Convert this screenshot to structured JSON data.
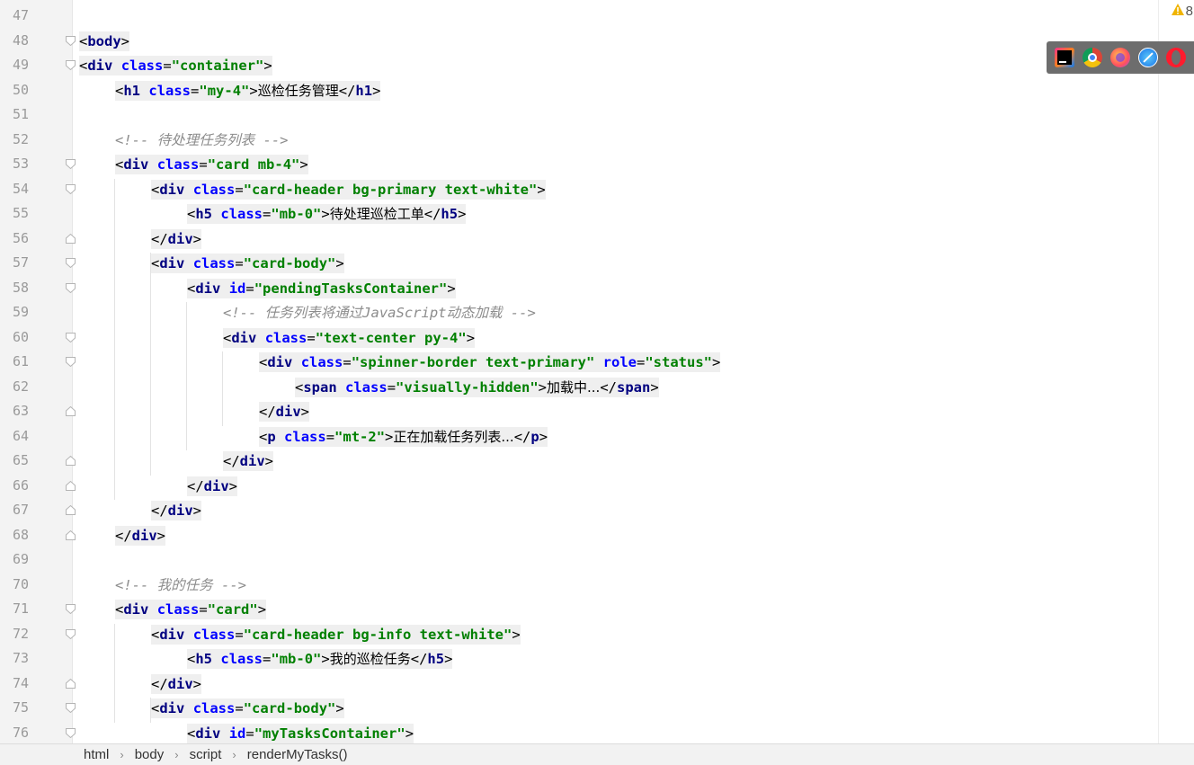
{
  "editor": {
    "lines": [
      {
        "n": "47",
        "indent": 0,
        "fold": "",
        "segs": []
      },
      {
        "n": "48",
        "indent": 0,
        "fold": "open",
        "segs": [
          [
            "punc",
            "<"
          ],
          [
            "tag",
            "body"
          ],
          [
            "punc",
            ">"
          ]
        ]
      },
      {
        "n": "49",
        "indent": 0,
        "fold": "open",
        "segs": [
          [
            "punc",
            "<"
          ],
          [
            "tag",
            "div"
          ],
          [
            "sp",
            " "
          ],
          [
            "attr",
            "class"
          ],
          [
            "punc",
            "="
          ],
          [
            "val",
            "\"container\""
          ],
          [
            "punc",
            ">"
          ]
        ]
      },
      {
        "n": "50",
        "indent": 1,
        "fold": "",
        "segs": [
          [
            "punc",
            "<"
          ],
          [
            "tag",
            "h1"
          ],
          [
            "sp",
            " "
          ],
          [
            "attr",
            "class"
          ],
          [
            "punc",
            "="
          ],
          [
            "val",
            "\"my-4\""
          ],
          [
            "punc",
            ">"
          ],
          [
            "txt",
            "巡检任务管理"
          ],
          [
            "punc",
            "</"
          ],
          [
            "tag",
            "h1"
          ],
          [
            "punc",
            ">"
          ]
        ]
      },
      {
        "n": "51",
        "indent": 0,
        "fold": "",
        "segs": []
      },
      {
        "n": "52",
        "indent": 1,
        "fold": "",
        "segs": [
          [
            "cmt",
            "<!-- 待处理任务列表 -->"
          ]
        ]
      },
      {
        "n": "53",
        "indent": 1,
        "fold": "open",
        "segs": [
          [
            "punc",
            "<"
          ],
          [
            "tag",
            "div"
          ],
          [
            "sp",
            " "
          ],
          [
            "attr",
            "class"
          ],
          [
            "punc",
            "="
          ],
          [
            "val",
            "\"card mb-4\""
          ],
          [
            "punc",
            ">"
          ]
        ]
      },
      {
        "n": "54",
        "indent": 2,
        "fold": "open",
        "segs": [
          [
            "punc",
            "<"
          ],
          [
            "tag",
            "div"
          ],
          [
            "sp",
            " "
          ],
          [
            "attr",
            "class"
          ],
          [
            "punc",
            "="
          ],
          [
            "val",
            "\"card-header bg-primary text-white\""
          ],
          [
            "punc",
            ">"
          ]
        ]
      },
      {
        "n": "55",
        "indent": 3,
        "fold": "",
        "segs": [
          [
            "punc",
            "<"
          ],
          [
            "tag",
            "h5"
          ],
          [
            "sp",
            " "
          ],
          [
            "attr",
            "class"
          ],
          [
            "punc",
            "="
          ],
          [
            "val",
            "\"mb-0\""
          ],
          [
            "punc",
            ">"
          ],
          [
            "txt",
            "待处理巡检工单"
          ],
          [
            "punc",
            "</"
          ],
          [
            "tag",
            "h5"
          ],
          [
            "punc",
            ">"
          ]
        ]
      },
      {
        "n": "56",
        "indent": 2,
        "fold": "close",
        "segs": [
          [
            "punc",
            "</"
          ],
          [
            "tag",
            "div"
          ],
          [
            "punc",
            ">"
          ]
        ]
      },
      {
        "n": "57",
        "indent": 2,
        "fold": "open",
        "segs": [
          [
            "punc",
            "<"
          ],
          [
            "tag",
            "div"
          ],
          [
            "sp",
            " "
          ],
          [
            "attr",
            "class"
          ],
          [
            "punc",
            "="
          ],
          [
            "val",
            "\"card-body\""
          ],
          [
            "punc",
            ">"
          ]
        ]
      },
      {
        "n": "58",
        "indent": 3,
        "fold": "open",
        "segs": [
          [
            "punc",
            "<"
          ],
          [
            "tag",
            "div"
          ],
          [
            "sp",
            " "
          ],
          [
            "attr",
            "id"
          ],
          [
            "punc",
            "="
          ],
          [
            "val",
            "\"pendingTasksContainer\""
          ],
          [
            "punc",
            ">"
          ]
        ]
      },
      {
        "n": "59",
        "indent": 4,
        "fold": "",
        "segs": [
          [
            "cmt",
            "<!-- 任务列表将通过JavaScript动态加载 -->"
          ]
        ]
      },
      {
        "n": "60",
        "indent": 4,
        "fold": "open",
        "segs": [
          [
            "punc",
            "<"
          ],
          [
            "tag",
            "div"
          ],
          [
            "sp",
            " "
          ],
          [
            "attr",
            "class"
          ],
          [
            "punc",
            "="
          ],
          [
            "val",
            "\"text-center py-4\""
          ],
          [
            "punc",
            ">"
          ]
        ]
      },
      {
        "n": "61",
        "indent": 5,
        "fold": "open",
        "segs": [
          [
            "punc",
            "<"
          ],
          [
            "tag",
            "div"
          ],
          [
            "sp",
            " "
          ],
          [
            "attr",
            "class"
          ],
          [
            "punc",
            "="
          ],
          [
            "val",
            "\"spinner-border text-primary\""
          ],
          [
            "sp",
            " "
          ],
          [
            "attr",
            "role"
          ],
          [
            "punc",
            "="
          ],
          [
            "val",
            "\"status\""
          ],
          [
            "punc",
            ">"
          ]
        ]
      },
      {
        "n": "62",
        "indent": 6,
        "fold": "",
        "segs": [
          [
            "punc",
            "<"
          ],
          [
            "tag",
            "span"
          ],
          [
            "sp",
            " "
          ],
          [
            "attr",
            "class"
          ],
          [
            "punc",
            "="
          ],
          [
            "val",
            "\"visually-hidden\""
          ],
          [
            "punc",
            ">"
          ],
          [
            "txt",
            "加载中..."
          ],
          [
            "punc",
            "</"
          ],
          [
            "tag",
            "span"
          ],
          [
            "punc",
            ">"
          ]
        ]
      },
      {
        "n": "63",
        "indent": 5,
        "fold": "close",
        "segs": [
          [
            "punc",
            "</"
          ],
          [
            "tag",
            "div"
          ],
          [
            "punc",
            ">"
          ]
        ]
      },
      {
        "n": "64",
        "indent": 5,
        "fold": "",
        "segs": [
          [
            "punc",
            "<"
          ],
          [
            "tag",
            "p"
          ],
          [
            "sp",
            " "
          ],
          [
            "attr",
            "class"
          ],
          [
            "punc",
            "="
          ],
          [
            "val",
            "\"mt-2\""
          ],
          [
            "punc",
            ">"
          ],
          [
            "txt",
            "正在加载任务列表..."
          ],
          [
            "punc",
            "</"
          ],
          [
            "tag",
            "p"
          ],
          [
            "punc",
            ">"
          ]
        ]
      },
      {
        "n": "65",
        "indent": 4,
        "fold": "close",
        "segs": [
          [
            "punc",
            "</"
          ],
          [
            "tag",
            "div"
          ],
          [
            "punc",
            ">"
          ]
        ]
      },
      {
        "n": "66",
        "indent": 3,
        "fold": "close",
        "segs": [
          [
            "punc",
            "</"
          ],
          [
            "tag",
            "div"
          ],
          [
            "punc",
            ">"
          ]
        ]
      },
      {
        "n": "67",
        "indent": 2,
        "fold": "close",
        "segs": [
          [
            "punc",
            "</"
          ],
          [
            "tag",
            "div"
          ],
          [
            "punc",
            ">"
          ]
        ]
      },
      {
        "n": "68",
        "indent": 1,
        "fold": "close",
        "segs": [
          [
            "punc",
            "</"
          ],
          [
            "tag",
            "div"
          ],
          [
            "punc",
            ">"
          ]
        ]
      },
      {
        "n": "69",
        "indent": 0,
        "fold": "",
        "segs": []
      },
      {
        "n": "70",
        "indent": 1,
        "fold": "",
        "segs": [
          [
            "cmt",
            "<!-- 我的任务 -->"
          ]
        ]
      },
      {
        "n": "71",
        "indent": 1,
        "fold": "open",
        "segs": [
          [
            "punc",
            "<"
          ],
          [
            "tag",
            "div"
          ],
          [
            "sp",
            " "
          ],
          [
            "attr",
            "class"
          ],
          [
            "punc",
            "="
          ],
          [
            "val",
            "\"card\""
          ],
          [
            "punc",
            ">"
          ]
        ]
      },
      {
        "n": "72",
        "indent": 2,
        "fold": "open",
        "segs": [
          [
            "punc",
            "<"
          ],
          [
            "tag",
            "div"
          ],
          [
            "sp",
            " "
          ],
          [
            "attr",
            "class"
          ],
          [
            "punc",
            "="
          ],
          [
            "val",
            "\"card-header bg-info text-white\""
          ],
          [
            "punc",
            ">"
          ]
        ]
      },
      {
        "n": "73",
        "indent": 3,
        "fold": "",
        "segs": [
          [
            "punc",
            "<"
          ],
          [
            "tag",
            "h5"
          ],
          [
            "sp",
            " "
          ],
          [
            "attr",
            "class"
          ],
          [
            "punc",
            "="
          ],
          [
            "val",
            "\"mb-0\""
          ],
          [
            "punc",
            ">"
          ],
          [
            "txt",
            "我的巡检任务"
          ],
          [
            "punc",
            "</"
          ],
          [
            "tag",
            "h5"
          ],
          [
            "punc",
            ">"
          ]
        ]
      },
      {
        "n": "74",
        "indent": 2,
        "fold": "close",
        "segs": [
          [
            "punc",
            "</"
          ],
          [
            "tag",
            "div"
          ],
          [
            "punc",
            ">"
          ]
        ]
      },
      {
        "n": "75",
        "indent": 2,
        "fold": "open",
        "segs": [
          [
            "punc",
            "<"
          ],
          [
            "tag",
            "div"
          ],
          [
            "sp",
            " "
          ],
          [
            "attr",
            "class"
          ],
          [
            "punc",
            "="
          ],
          [
            "val",
            "\"card-body\""
          ],
          [
            "punc",
            ">"
          ]
        ]
      },
      {
        "n": "76",
        "indent": 3,
        "fold": "open",
        "segs": [
          [
            "punc",
            "<"
          ],
          [
            "tag",
            "div"
          ],
          [
            "sp",
            " "
          ],
          [
            "attr",
            "id"
          ],
          [
            "punc",
            "="
          ],
          [
            "val",
            "\"myTasksContainer\""
          ],
          [
            "punc",
            ">"
          ]
        ]
      }
    ]
  },
  "inspections": {
    "warning_count": "8",
    "warning_icon": "warning-triangle-icon"
  },
  "browsers": [
    "intellij-icon",
    "chrome-icon",
    "firefox-icon",
    "safari-icon",
    "opera-icon"
  ],
  "breadcrumb": [
    "html",
    "body",
    "script",
    "renderMyTasks()"
  ],
  "colors": {
    "tag": "#000080",
    "attr": "#0000ff",
    "value": "#008000",
    "comment": "#8c8c8c",
    "gutter": "#f3f3f3"
  }
}
